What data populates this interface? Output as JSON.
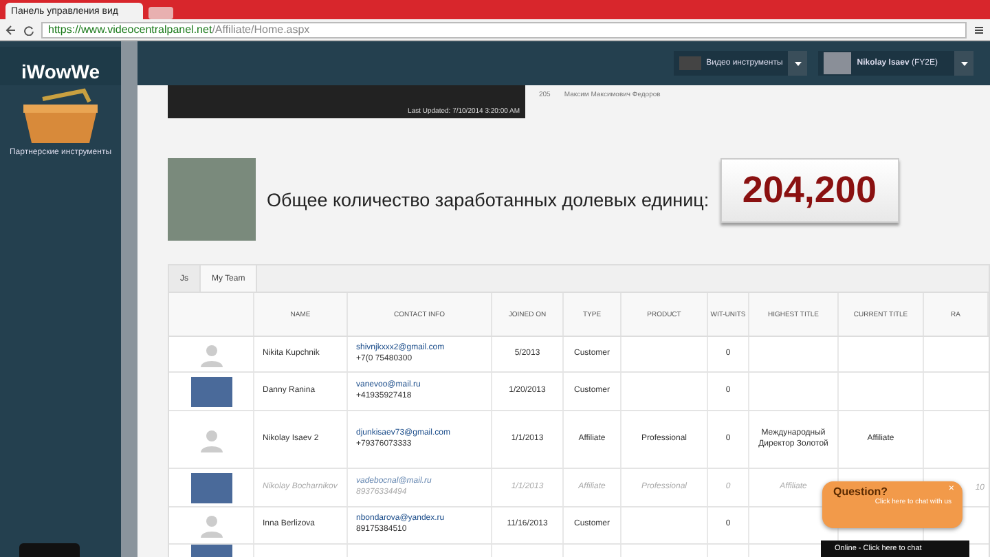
{
  "browser": {
    "tab_title": "Панель управления вид",
    "url_host": "https://www.videocentralpanel.net",
    "url_path": "/Affiliate/Home.aspx"
  },
  "header": {
    "tools_label": "Видео инструменты",
    "user_name": "Nikolay Isaev",
    "user_id": "(FY2E)"
  },
  "sidebar": {
    "logo": "iWowWe",
    "items": [
      {
        "label": "Партнерские инструменты"
      }
    ]
  },
  "banner": {
    "updated": "Last Updated: 7/10/2014 3:20:00 AM",
    "count": "205",
    "text": "Максим Максимович Федоров"
  },
  "earnings": {
    "label": "Общее количество заработанных долевых единиц:",
    "value": "204,200"
  },
  "team": {
    "tabs": [
      {
        "label": "Js",
        "selected": false
      },
      {
        "label": "My Team",
        "selected": true
      }
    ],
    "columns": [
      "",
      "NAME",
      "CONTACT INFO",
      "JOINED ON",
      "TYPE",
      "PRODUCT",
      "WIT-UNITS",
      "HIGHEST TITLE",
      "CURRENT TITLE",
      "RA"
    ],
    "rows": [
      {
        "kind": "silhouette",
        "inactive": false,
        "name": "Nikita Kupchnik",
        "email": "shivnjkxxx2@gmail.com",
        "phone": "+7(0 75480300",
        "joined": "5/2013",
        "type": "Customer",
        "product": "",
        "units": "0",
        "highest": "",
        "current": "",
        "extra": ""
      },
      {
        "kind": "photo",
        "inactive": false,
        "name": "Danny Ranina",
        "email": "vanevoo@mail.ru",
        "phone": "+41935927418",
        "joined": "1/20/2013",
        "type": "Customer",
        "product": "",
        "units": "0",
        "highest": "",
        "current": "",
        "extra": ""
      },
      {
        "kind": "silhouette",
        "inactive": false,
        "name": "Nikolay Isaev 2",
        "email": "djunkisaev73@gmail.com",
        "phone": "+79376073333",
        "joined": "1/1/2013",
        "type": "Affiliate",
        "product": "Professional",
        "units": "0",
        "highest": "Международный Директор Золотой",
        "current": "Affiliate",
        "extra": ""
      },
      {
        "kind": "photo",
        "inactive": true,
        "name": "Nikolay Bocharnikov",
        "email": "vadebocnal@mail.ru",
        "phone": "89376334494",
        "joined": "1/1/2013",
        "type": "Affiliate",
        "product": "Professional",
        "units": "0",
        "highest": "Affiliate",
        "current": "",
        "extra": "10"
      },
      {
        "kind": "silhouette",
        "inactive": false,
        "name": "Inna Berlizova",
        "email": "nbondarova@yandex.ru",
        "phone": "89175384510",
        "joined": "11/16/2013",
        "type": "Customer",
        "product": "",
        "units": "0",
        "highest": "",
        "current": "",
        "extra": ""
      },
      {
        "kind": "photo"
      }
    ]
  },
  "chat": {
    "title": "Question?",
    "subtitle": "Click here to chat with us",
    "bar": "Online - Click here to chat",
    "close": "×"
  }
}
